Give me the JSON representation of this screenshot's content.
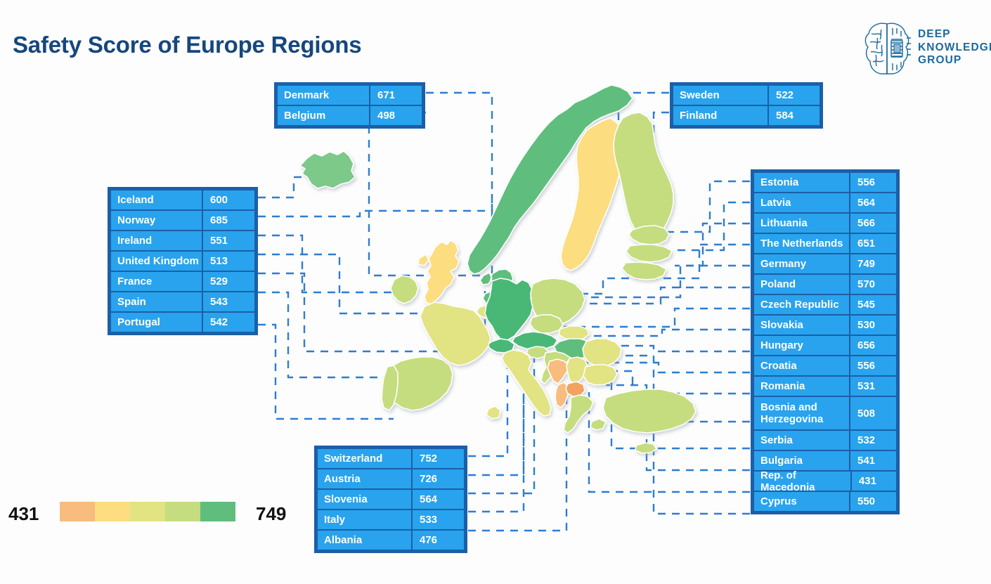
{
  "title": "Safety Score of Europe Regions",
  "logo": {
    "icon": "brain-circuit-icon",
    "line1": "DEEP",
    "line2": "KNOWLEDGE",
    "line3": "GROUP",
    "color": "#1b6a9c"
  },
  "theme": {
    "title_color": "#16477e",
    "table_frame": "#1b5fa8",
    "table_cell": "#29a3ee",
    "table_text": "#ffffff",
    "leader_line": "#2d7dd2",
    "background": "#fdfdfd"
  },
  "legend": {
    "min": "431",
    "max": "749",
    "swatches": [
      "#f8bc7e",
      "#fcdd80",
      "#e2e383",
      "#c5dd7f",
      "#5fbe7d"
    ]
  },
  "tables": {
    "north": {
      "rows": [
        {
          "name": "Denmark",
          "value": "671"
        },
        {
          "name": "Belgium",
          "value": "498"
        }
      ]
    },
    "northeast": {
      "rows": [
        {
          "name": "Sweden",
          "value": "522"
        },
        {
          "name": "Finland",
          "value": "584"
        }
      ]
    },
    "west": {
      "rows": [
        {
          "name": "Iceland",
          "value": "600"
        },
        {
          "name": "Norway",
          "value": "685"
        },
        {
          "name": "Ireland",
          "value": "551"
        },
        {
          "name": "United Kingdom",
          "value": "513"
        },
        {
          "name": "France",
          "value": "529"
        },
        {
          "name": "Spain",
          "value": "543"
        },
        {
          "name": "Portugal",
          "value": "542"
        }
      ]
    },
    "south": {
      "rows": [
        {
          "name": "Switzerland",
          "value": "752"
        },
        {
          "name": "Austria",
          "value": "726"
        },
        {
          "name": "Slovenia",
          "value": "564"
        },
        {
          "name": "Italy",
          "value": "533"
        },
        {
          "name": "Albania",
          "value": "476"
        }
      ]
    },
    "east": {
      "rows": [
        {
          "name": "Estonia",
          "value": "556"
        },
        {
          "name": "Latvia",
          "value": "564"
        },
        {
          "name": "Lithuania",
          "value": "566"
        },
        {
          "name": "The Netherlands",
          "value": "651"
        },
        {
          "name": "Germany",
          "value": "749"
        },
        {
          "name": "Poland",
          "value": "570"
        },
        {
          "name": "Czech Republic",
          "value": "545"
        },
        {
          "name": "Slovakia",
          "value": "530"
        },
        {
          "name": "Hungary",
          "value": "656"
        },
        {
          "name": "Croatia",
          "value": "556"
        },
        {
          "name": "Romania",
          "value": "531"
        },
        {
          "name": "Bosnia and Herzegovina",
          "value": "508",
          "tall": true
        },
        {
          "name": "Serbia",
          "value": "532"
        },
        {
          "name": "Bulgaria",
          "value": "541"
        },
        {
          "name": "Rep. of Macedonia",
          "value": "431"
        },
        {
          "name": "Cyprus",
          "value": "550"
        }
      ]
    }
  },
  "chart_data": {
    "type": "map",
    "title": "Safety Score of Europe Regions",
    "value_label": "Safety Score",
    "scale_min": 431,
    "scale_max": 749,
    "colors": [
      "#f8bc7e",
      "#fcdd80",
      "#e2e383",
      "#c5dd7f",
      "#5fbe7d"
    ],
    "regions": [
      {
        "name": "Denmark",
        "value": 671
      },
      {
        "name": "Belgium",
        "value": 498
      },
      {
        "name": "Sweden",
        "value": 522
      },
      {
        "name": "Finland",
        "value": 584
      },
      {
        "name": "Iceland",
        "value": 600
      },
      {
        "name": "Norway",
        "value": 685
      },
      {
        "name": "Ireland",
        "value": 551
      },
      {
        "name": "United Kingdom",
        "value": 513
      },
      {
        "name": "France",
        "value": 529
      },
      {
        "name": "Spain",
        "value": 543
      },
      {
        "name": "Portugal",
        "value": 542
      },
      {
        "name": "Switzerland",
        "value": 752
      },
      {
        "name": "Austria",
        "value": 726
      },
      {
        "name": "Slovenia",
        "value": 564
      },
      {
        "name": "Italy",
        "value": 533
      },
      {
        "name": "Albania",
        "value": 476
      },
      {
        "name": "Estonia",
        "value": 556
      },
      {
        "name": "Latvia",
        "value": 564
      },
      {
        "name": "Lithuania",
        "value": 566
      },
      {
        "name": "The Netherlands",
        "value": 651
      },
      {
        "name": "Germany",
        "value": 749
      },
      {
        "name": "Poland",
        "value": 570
      },
      {
        "name": "Czech Republic",
        "value": 545
      },
      {
        "name": "Slovakia",
        "value": 530
      },
      {
        "name": "Hungary",
        "value": 656
      },
      {
        "name": "Croatia",
        "value": 556
      },
      {
        "name": "Romania",
        "value": 531
      },
      {
        "name": "Bosnia and Herzegovina",
        "value": 508
      },
      {
        "name": "Serbia",
        "value": 532
      },
      {
        "name": "Bulgaria",
        "value": 541
      },
      {
        "name": "Rep. of Macedonia",
        "value": 431
      },
      {
        "name": "Cyprus",
        "value": 550
      }
    ]
  }
}
